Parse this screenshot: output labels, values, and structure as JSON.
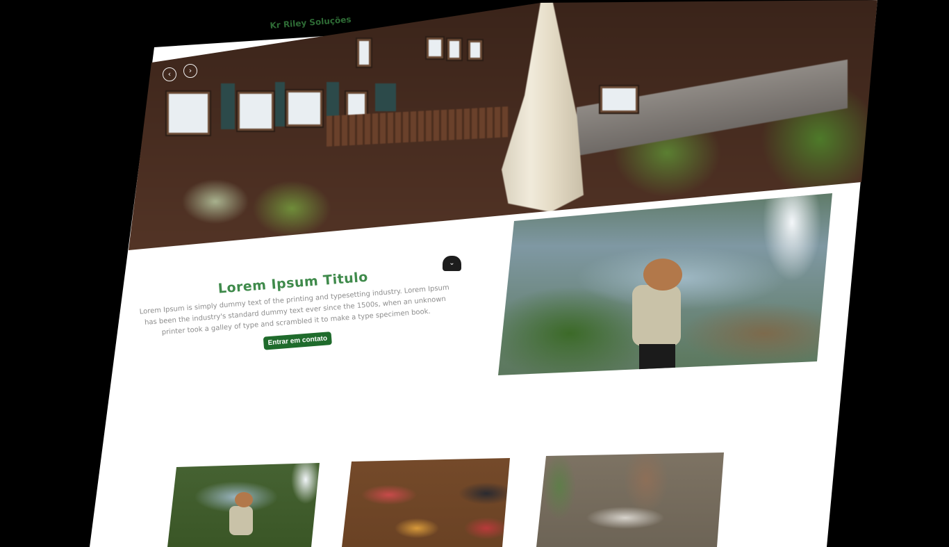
{
  "header": {
    "brand": "Kr Riley Soluções"
  },
  "hero": {
    "image": "chalet-hotel-photo",
    "prev_icon": "‹",
    "next_icon": "›"
  },
  "scroll_button": {
    "icon": "chevron-down-icon",
    "glyph": "⌄"
  },
  "intro": {
    "title": "Lorem Ipsum Titulo",
    "description": "Lorem Ipsum is simply dummy text of the printing and typesetting industry. Lorem Ipsum has been the industry's standard dummy text ever since the 1500s, when an unknown printer took a galley of type and scrambled it to make a type specimen book.",
    "cta_label": "Entrar em contato"
  },
  "feature_image": {
    "subject": "hiker-at-waterfall-photo"
  },
  "gallery": {
    "items": [
      {
        "subject": "hiker-at-waterfall-photo"
      },
      {
        "subject": "food-platters-photo"
      },
      {
        "subject": "hotel-room-photo"
      }
    ]
  },
  "colors": {
    "accent": "#3f8a4b",
    "brand": "#2e6b35",
    "button": "#1f6b2c",
    "text_muted": "#8d8d8d",
    "background": "#ffffff"
  }
}
